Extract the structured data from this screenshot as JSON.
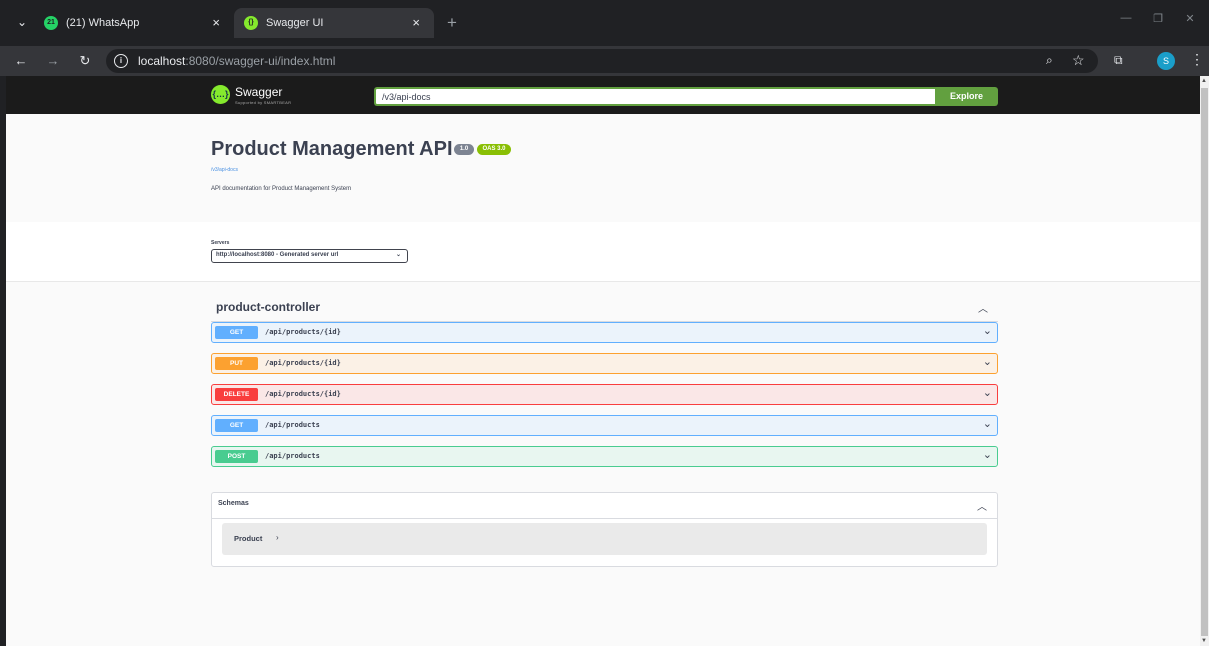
{
  "browser": {
    "tabs": [
      {
        "title": "(21) WhatsApp",
        "favicon": "whatsapp-icon",
        "badge": "21",
        "active": false
      },
      {
        "title": "Swagger UI",
        "favicon": "swagger-icon",
        "badge": "{}",
        "active": true
      }
    ],
    "new_tab": "+",
    "close": "×",
    "url_host": "localhost",
    "url_rest": ":8080/swagger-ui/index.html",
    "profile_initial": "S",
    "colors": {
      "tab_strip": "#202124",
      "toolbar": "#35363a",
      "profile": "#1a9ec9"
    }
  },
  "swagger": {
    "logo_text": "Swagger",
    "logo_sub": "Supported by SMARTBEAR",
    "logo_mark": "{…}",
    "url_value": "/v3/api-docs",
    "explore_label": "Explore",
    "colors": {
      "topbar": "#1b1b1b",
      "explore": "#62a03f"
    }
  },
  "info": {
    "title": "Product Management API",
    "version": "1.0",
    "oas": "OAS 3.0",
    "docs_link": "/v3/api-docs",
    "description": "API documentation for Product Management System"
  },
  "servers": {
    "label": "Servers",
    "selected": "http://localhost:8080 - Generated server url"
  },
  "tag": {
    "name": "product-controller"
  },
  "operations": [
    {
      "method": "GET",
      "path": "/api/products/{id}",
      "color": "#61affe"
    },
    {
      "method": "PUT",
      "path": "/api/products/{id}",
      "color": "#fca130"
    },
    {
      "method": "DELETE",
      "path": "/api/products/{id}",
      "color": "#f93e3e"
    },
    {
      "method": "GET",
      "path": "/api/products",
      "color": "#61affe"
    },
    {
      "method": "POST",
      "path": "/api/products",
      "color": "#49cc90"
    }
  ],
  "schemas": {
    "title": "Schemas",
    "models": [
      {
        "name": "Product"
      }
    ]
  }
}
